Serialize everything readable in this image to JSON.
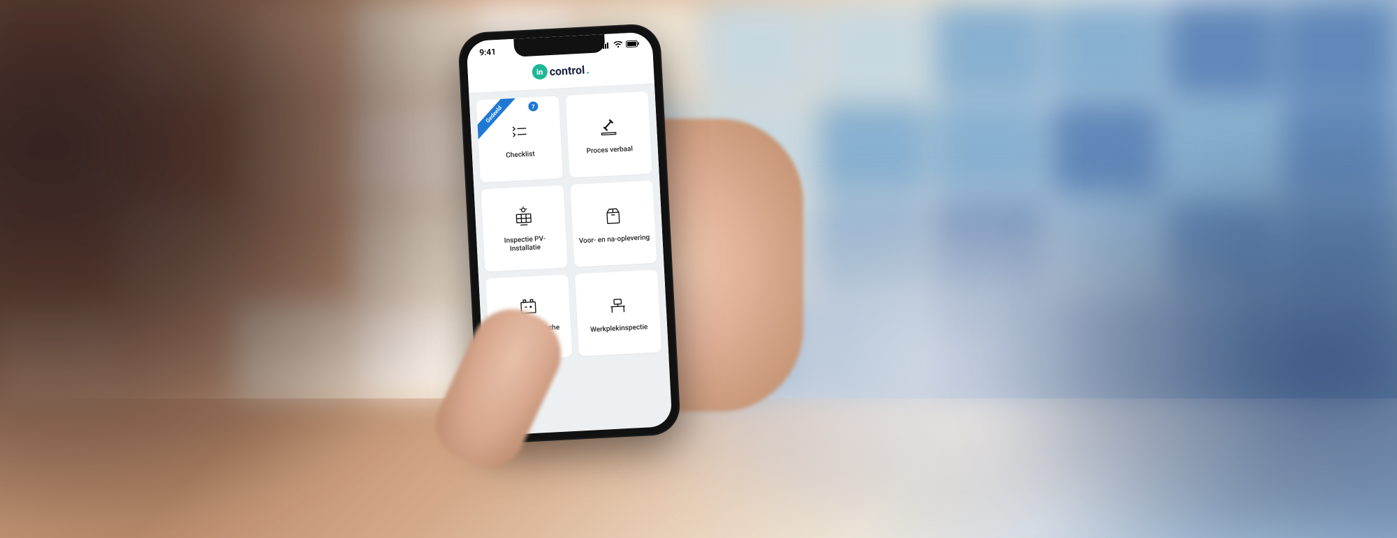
{
  "status_bar": {
    "time": "9:41"
  },
  "app": {
    "logo_prefix": "in",
    "logo_text": "control",
    "logo_dot": "."
  },
  "ribbon_label": "Gedeeld",
  "badge_count": "7",
  "tiles": [
    {
      "label": "Checklist",
      "icon": "checklist"
    },
    {
      "label": "Proces verbaal",
      "icon": "gavel"
    },
    {
      "label": "Inspectie PV-Installatie",
      "icon": "solar"
    },
    {
      "label": "Voor- en na-oplevering",
      "icon": "box"
    },
    {
      "label": "Keuring elektrische installatie",
      "icon": "battery"
    },
    {
      "label": "Werkplekinspectie",
      "icon": "desk"
    }
  ]
}
